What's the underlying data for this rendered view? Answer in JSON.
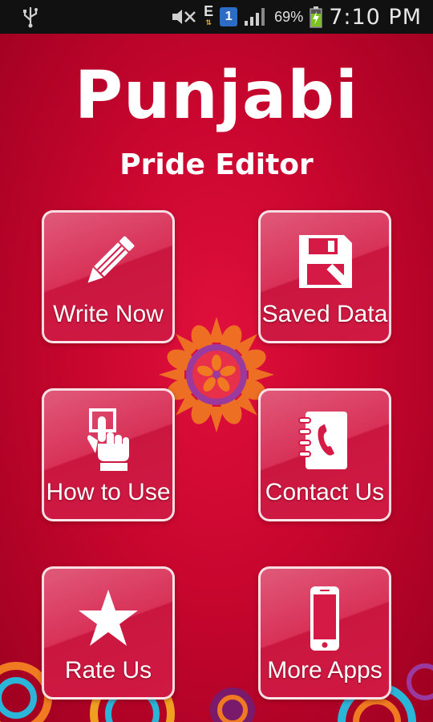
{
  "status_bar": {
    "network_label": "E",
    "notification_count": "1",
    "battery_percent": "69%",
    "time": "7:10 PM"
  },
  "header": {
    "title": "Punjabi",
    "subtitle": "Pride Editor"
  },
  "menu": {
    "write_now": {
      "label": "Write Now",
      "icon": "pencil-icon"
    },
    "saved_data": {
      "label": "Saved Data",
      "icon": "floppy-disk-icon"
    },
    "how_to_use": {
      "label": "How to Use",
      "icon": "touch-hand-icon"
    },
    "contact_us": {
      "label": "Contact Us",
      "icon": "phone-book-icon"
    },
    "rate_us": {
      "label": "Rate Us",
      "icon": "star-icon"
    },
    "more_apps": {
      "label": "More Apps",
      "icon": "smartphone-icon"
    }
  },
  "colors": {
    "background": "#c8062e",
    "tile": "#d41a45",
    "accent_orange": "#f07a22",
    "accent_purple": "#9a3a9e"
  }
}
